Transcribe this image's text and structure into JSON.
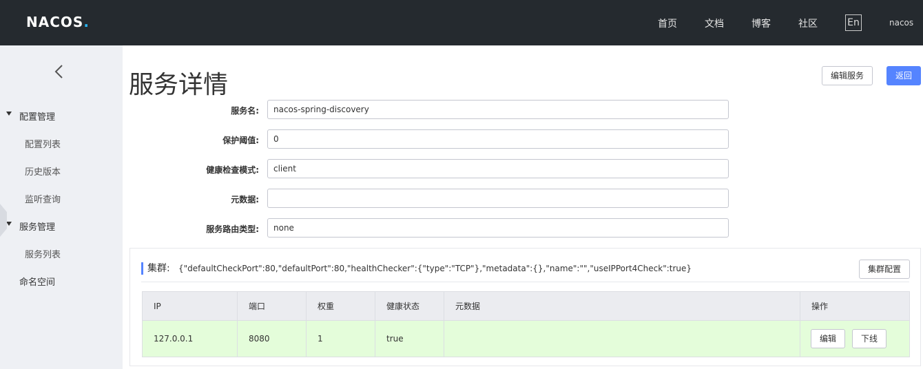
{
  "app": {
    "logo_text": "NACOS",
    "logo_dot": "."
  },
  "topnav": {
    "items": [
      "首页",
      "文档",
      "博客",
      "社区"
    ],
    "lang": "En",
    "user": "nacos"
  },
  "sidebar": {
    "groups": [
      {
        "label": "配置管理",
        "items": [
          "配置列表",
          "历史版本",
          "监听查询"
        ]
      },
      {
        "label": "服务管理",
        "items": [
          "服务列表"
        ]
      }
    ],
    "namespace": "命名空间"
  },
  "page": {
    "title": "服务详情",
    "edit_service_label": "编辑服务",
    "back_label": "返回"
  },
  "form": {
    "service_name": {
      "label": "服务名:",
      "value": "nacos-spring-discovery"
    },
    "protect_threshold": {
      "label": "保护阈值:",
      "value": "0"
    },
    "health_check_mode": {
      "label": "健康检查模式:",
      "value": "client"
    },
    "metadata": {
      "label": "元数据:",
      "value": ""
    },
    "route_type": {
      "label": "服务路由类型:",
      "value": "none"
    }
  },
  "cluster": {
    "label": "集群:",
    "json": "{\"defaultCheckPort\":80,\"defaultPort\":80,\"healthChecker\":{\"type\":\"TCP\"},\"metadata\":{},\"name\":\"\",\"useIPPort4Check\":true}",
    "config_label": "集群配置",
    "columns": [
      "IP",
      "端口",
      "权重",
      "健康状态",
      "元数据",
      "操作"
    ],
    "rows": [
      {
        "ip": "127.0.0.1",
        "port": "8080",
        "weight": "1",
        "healthy": "true",
        "metadata": "",
        "edit_label": "编辑",
        "offline_label": "下线"
      }
    ]
  },
  "colors": {
    "topbar": "#252a2f",
    "primary": "#5584ff",
    "row_healthy": "#e4fdda"
  }
}
